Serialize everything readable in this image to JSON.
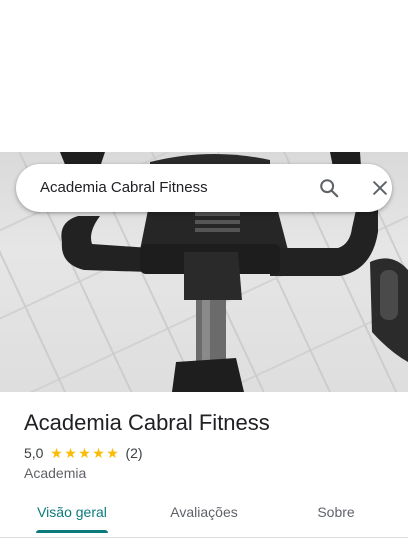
{
  "search": {
    "query": "Academia Cabral Fitness"
  },
  "place": {
    "title": "Academia Cabral Fitness",
    "rating": "5,0",
    "review_count": "(2)",
    "stars": 5,
    "category": "Academia"
  },
  "tabs": [
    {
      "label": "Visão geral",
      "active": true
    },
    {
      "label": "Avaliações",
      "active": false
    },
    {
      "label": "Sobre",
      "active": false
    }
  ],
  "colors": {
    "accent": "#0b7a7c",
    "star": "#fbbc04"
  },
  "icons": {
    "search": "search-icon",
    "close": "close-icon"
  }
}
